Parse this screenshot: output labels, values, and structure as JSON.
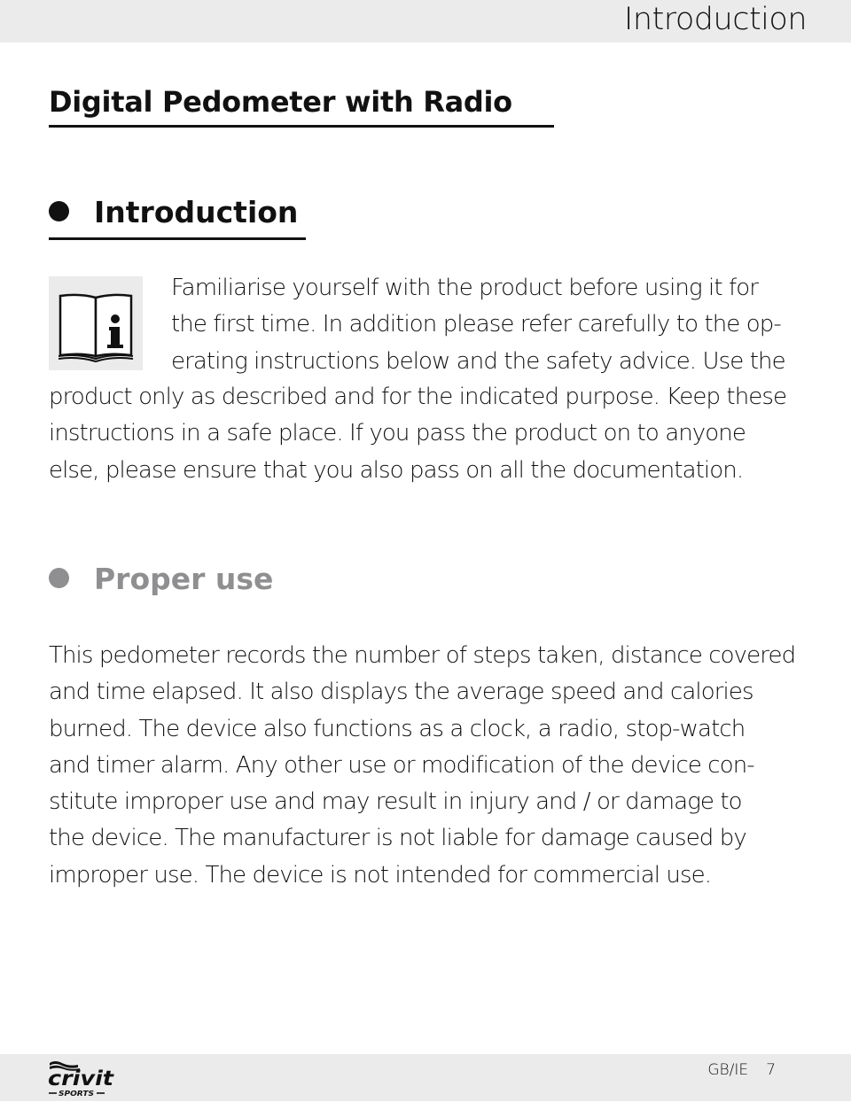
{
  "header": {
    "running_title": "Introduction"
  },
  "document": {
    "title": "Digital Pedometer with Radio"
  },
  "sections": {
    "introduction": {
      "heading": "Introduction",
      "icon": "info-book-icon",
      "lines_beside_icon": [
        "Familiarise yourself with the product before using it for",
        "the first time. In addition please refer carefully to the op-",
        "erating instructions below and the safety advice. Use the"
      ],
      "lines_full_width": [
        "product only as described and for the indicated purpose. Keep these",
        "instructions in a safe place. If you pass the product on to anyone",
        "else, please ensure that you also pass on all the documentation."
      ]
    },
    "proper_use": {
      "heading": "Proper use",
      "heading_color": "#8f8f91",
      "lines": [
        "This pedometer records the number of steps taken, distance covered",
        "and time elapsed. It also displays the average speed and calories",
        "burned. The device also functions as a clock, a radio, stop-watch",
        "and timer alarm. Any other use or modification of the device con-",
        "stitute improper use and may result in injury and / or damage to",
        "the device. The manufacturer is not liable for damage caused by",
        "improper use. The device is not intended for commercial use."
      ]
    }
  },
  "footer": {
    "brand": "crivit",
    "brand_sub": "SPORTS",
    "locale": "GB/IE",
    "page_number": "7"
  },
  "colors": {
    "band_background": "#ebebeb",
    "text": "#111111",
    "muted_heading": "#8f8f91"
  }
}
